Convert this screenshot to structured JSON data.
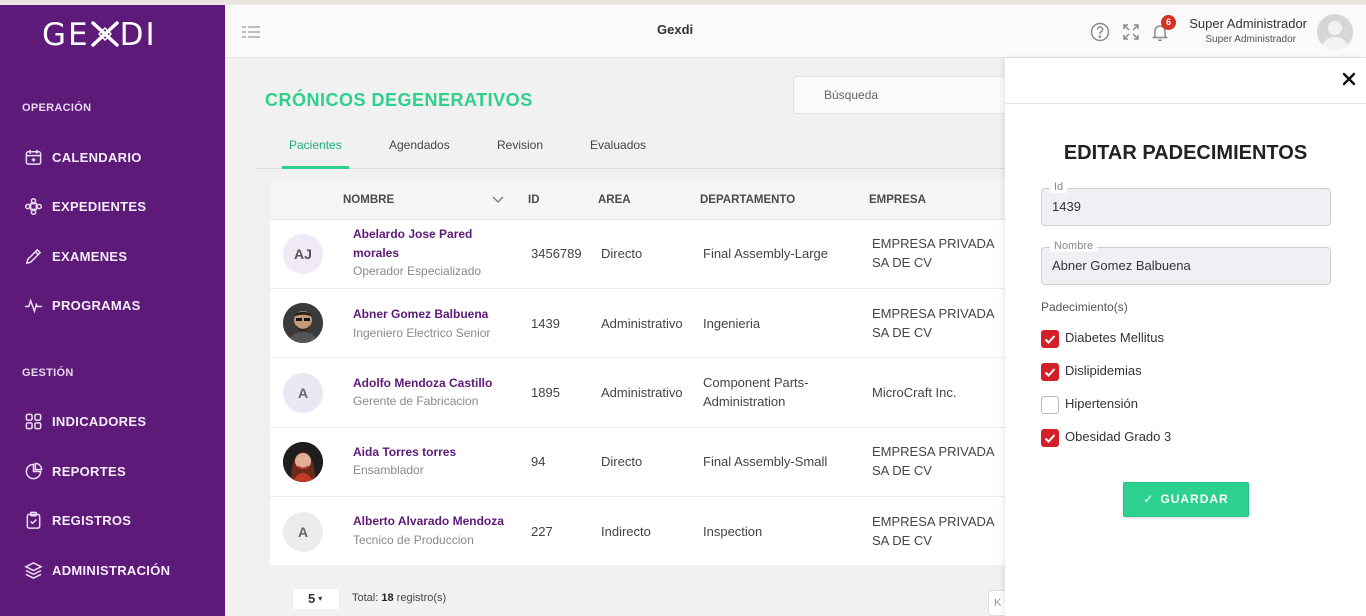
{
  "app": {
    "logo_text_left": "GE",
    "logo_text_right": "DI",
    "header_title": "Gexdi",
    "notification_count": "6",
    "user_name": "Super Administrador",
    "user_role": "Super Administrador"
  },
  "sidebar": {
    "section_operation": "OPERACIÓN",
    "section_management": "GESTIÓN",
    "items": [
      {
        "label": "CALENDARIO",
        "icon": "calendar-icon"
      },
      {
        "label": "EXPEDIENTES",
        "icon": "puzzle-icon"
      },
      {
        "label": "EXAMENES",
        "icon": "pencil-icon"
      },
      {
        "label": "PROGRAMAS",
        "icon": "pulse-icon"
      },
      {
        "label": "INDICADORES",
        "icon": "grid-icon"
      },
      {
        "label": "REPORTES",
        "icon": "pie-chart-icon"
      },
      {
        "label": "REGISTROS",
        "icon": "clipboard-check-icon"
      },
      {
        "label": "ADMINISTRACIÓN",
        "icon": "layers-icon"
      }
    ]
  },
  "main": {
    "page_title": "CRÓNICOS DEGENERATIVOS",
    "search_placeholder": "Búsqueda",
    "tabs": [
      {
        "label": "Pacientes",
        "active": true
      },
      {
        "label": "Agendados",
        "active": false
      },
      {
        "label": "Revision",
        "active": false
      },
      {
        "label": "Evaluados",
        "active": false
      }
    ],
    "columns": [
      "NOMBRE",
      "ID",
      "AREA",
      "DEPARTAMENTO",
      "EMPRESA"
    ],
    "rows": [
      {
        "initials": "AJ",
        "name": "Abelardo Jose Pared morales",
        "job": "Operador Especializado",
        "id": "3456789",
        "area": "Directo",
        "department": "Final Assembly-Large",
        "company": "EMPRESA PRIVADA SA DE CV",
        "photo": false
      },
      {
        "initials": "",
        "name": "Abner Gomez Balbuena",
        "job": "Ingeniero Electrico Senior",
        "id": "1439",
        "area": "Administrativo",
        "department": "Ingenieria",
        "company": "EMPRESA PRIVADA SA DE CV",
        "photo": true
      },
      {
        "initials": "A",
        "name": "Adolfo Mendoza Castillo",
        "job": "Gerente de Fabricacion",
        "id": "1895",
        "area": "Administrativo",
        "department": "Component Parts-Administration",
        "company": "MicroCraft Inc.",
        "photo": false
      },
      {
        "initials": "",
        "name": "Aida Torres torres",
        "job": "Ensamblador",
        "id": "94",
        "area": "Directo",
        "department": "Final Assembly-Small",
        "company": "EMPRESA PRIVADA SA DE CV",
        "photo": true
      },
      {
        "initials": "A",
        "name": "Alberto Alvarado Mendoza",
        "job": "Tecnico de Produccion",
        "id": "227",
        "area": "Indirecto",
        "department": "Inspection",
        "company": "EMPRESA PRIVADA SA DE CV",
        "photo": false
      }
    ],
    "page_size": "5",
    "total_label": "Total:",
    "total_count": "18",
    "total_suffix": "registro(s)",
    "pager_stub": "K"
  },
  "drawer": {
    "title": "EDITAR PADECIMIENTOS",
    "id_label": "Id",
    "id_value": "1439",
    "name_label": "Nombre",
    "name_value": "Abner Gomez Balbuena",
    "conditions_label": "Padecimiento(s)",
    "conditions": [
      {
        "label": "Diabetes Mellitus",
        "checked": true
      },
      {
        "label": "Dislipidemias",
        "checked": true
      },
      {
        "label": "Hipertensión",
        "checked": false
      },
      {
        "label": "Obesidad Grado 3",
        "checked": true
      }
    ],
    "save_label": "GUARDAR"
  },
  "colors": {
    "sidebar": "#5d1a78",
    "accent_green": "#2fcf8e",
    "checkbox_red": "#d21f2a",
    "badge_red": "#d63222"
  }
}
